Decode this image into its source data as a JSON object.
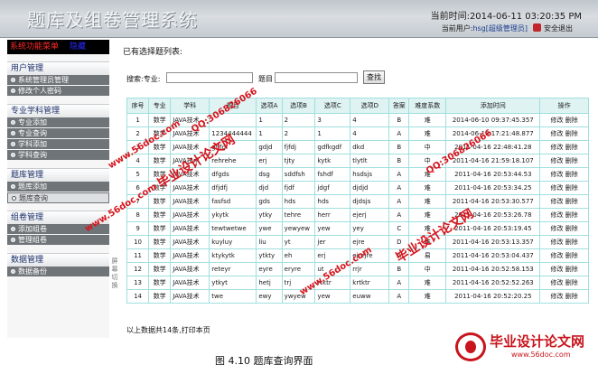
{
  "header": {
    "title": "题库及组卷管理系统",
    "time_label": "当前时间:2014-06-11 03:20:35 PM",
    "user_prefix": "当前用户:",
    "user_name": "hsg[超级管理员]",
    "exit_label": "安全退出"
  },
  "sidebar": {
    "menu_title": "系统功能菜单",
    "hide_label": "隐藏",
    "groups": [
      {
        "title": "用户管理",
        "items": [
          "系统管理员管理",
          "修改个人密码"
        ]
      },
      {
        "title": "专业学科管理",
        "items": [
          "专业添加",
          "专业查询",
          "学科添加",
          "学科查询"
        ]
      },
      {
        "title": "题库管理",
        "items": [
          "题库添加",
          "题库查询"
        ]
      },
      {
        "title": "组卷管理",
        "items": [
          "添加组卷",
          "管理组卷"
        ]
      },
      {
        "title": "数据管理",
        "items": [
          "数据备份"
        ]
      }
    ],
    "collapse_label": "屏幕切换"
  },
  "main": {
    "selected_label": "已有选择题列表:",
    "search_label": "搜索:专业:",
    "question_label": "题目",
    "search_button": "查找",
    "columns": [
      "序号",
      "专业",
      "学科",
      "题目",
      "选项A",
      "选项B",
      "选项C",
      "选项D",
      "答案",
      "难度系数",
      "添加时间",
      "操作"
    ],
    "rows": [
      [
        "1",
        "数学",
        "JAVA技术",
        "",
        "1",
        "2",
        "3",
        "4",
        "B",
        "难",
        "2014-06-10 09:37:45.357"
      ],
      [
        "2",
        "数学",
        "JAVA技术",
        "1234444444",
        "1",
        "2",
        "1",
        "4",
        "A",
        "难",
        "2014-06-10 17:21:48.877"
      ],
      [
        "3",
        "数学",
        "JAVA技术",
        "gfjfg",
        "gdjd",
        "fjfdj",
        "gdfkgdf",
        "dkd",
        "B",
        "中",
        "2011-04-16 22:48:41.28"
      ],
      [
        "4",
        "数学",
        "JAVA技术",
        "rehrehe",
        "erj",
        "tjty",
        "kytk",
        "tlytlt",
        "B",
        "中",
        "2011-04-16 21:59:18.107"
      ],
      [
        "5",
        "数学",
        "JAVA技术",
        "dfgds",
        "dsg",
        "sddfsh",
        "fshdf",
        "hsdsjs",
        "A",
        "难",
        "2011-04-16 20:53:44.53"
      ],
      [
        "6",
        "数学",
        "JAVA技术",
        "dfjdfj",
        "djd",
        "fjdf",
        "jdgf",
        "djdjd",
        "A",
        "难",
        "2011-04-16 20:53:34.25"
      ],
      [
        "7",
        "数学",
        "JAVA技术",
        "fasfsd",
        "gds",
        "hds",
        "hds",
        "djdsjs",
        "A",
        "难",
        "2011-04-16 20:53:30.577"
      ],
      [
        "8",
        "数学",
        "JAVA技术",
        "ykytk",
        "ytky",
        "tehre",
        "herr",
        "ejerj",
        "A",
        "难",
        "2011-04-16 20:53:26.78"
      ],
      [
        "9",
        "数学",
        "JAVA技术",
        "tewtwetwe",
        "ywe",
        "yewyew",
        "yew",
        "yey",
        "C",
        "难",
        "2011-04-16 20:53:19.45"
      ],
      [
        "10",
        "数学",
        "JAVA技术",
        "kuyluy",
        "liu",
        "yt",
        "jer",
        "ejre",
        "D",
        "难",
        "2011-04-16 20:53:13.357"
      ],
      [
        "11",
        "数学",
        "JAVA技术",
        "ktykytk",
        "ytkty",
        "eh",
        "erj",
        "ejrejre",
        "A",
        "易",
        "2011-04-16 20:53:04.437"
      ],
      [
        "12",
        "数学",
        "JAVA技术",
        "reteyr",
        "eyre",
        "eryre",
        "ut",
        "rrjr",
        "B",
        "中",
        "2011-04-16 20:52:58.153"
      ],
      [
        "13",
        "数学",
        "JAVA技术",
        "ytkyt",
        "hetj",
        "trj",
        "rtktr",
        "krtktr",
        "A",
        "难",
        "2011-04-16 20:52:52.263"
      ],
      [
        "14",
        "数学",
        "JAVA技术",
        "twe",
        "ewy",
        "ywyew",
        "yew",
        "euww",
        "A",
        "难",
        "2011-04-16 20:52:20.25"
      ]
    ],
    "edit_label": "修改",
    "delete_label": "删除",
    "footer": "以上数据共14条,打印本页"
  },
  "caption": "图 4.10 题库查询界面",
  "watermarks": {
    "brand": "毕业设计论文网",
    "site": "www.56doc.com",
    "qq": "QQ:306826066"
  },
  "logo": {
    "text": "毕业设计论文网",
    "url": "www.56doc.com"
  },
  "colors": {
    "menu_bg": "#000000",
    "menu_text": "#ff2a2a",
    "table_border": "#9fdfdf",
    "watermark": "#d6141c"
  }
}
